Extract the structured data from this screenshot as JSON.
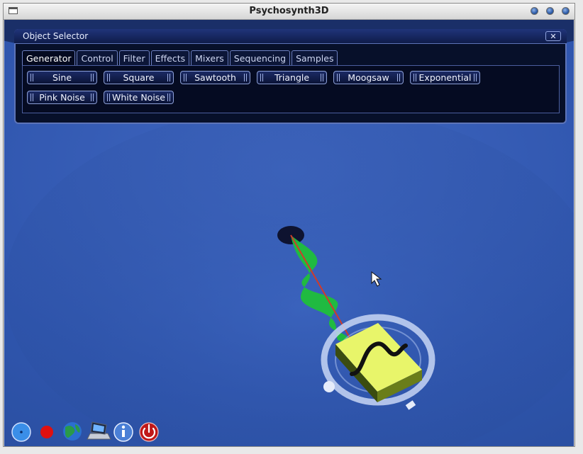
{
  "window": {
    "title": "Psychosynth3D"
  },
  "object_selector": {
    "title": "Object Selector",
    "close_glyph": "✕",
    "tabs": [
      {
        "label": "Generator",
        "active": true
      },
      {
        "label": "Control",
        "active": false
      },
      {
        "label": "Filter",
        "active": false
      },
      {
        "label": "Effects",
        "active": false
      },
      {
        "label": "Mixers",
        "active": false
      },
      {
        "label": "Sequencing",
        "active": false
      },
      {
        "label": "Samples",
        "active": false
      }
    ],
    "generator_buttons": [
      "Sine",
      "Square",
      "Sawtooth",
      "Triangle",
      "Moogsaw",
      "Exponential",
      "Pink Noise",
      "White Noise"
    ]
  },
  "scene": {
    "background_color": "#2f55ad",
    "wave_color": "#1fbf3a",
    "connection_color": "#d13a2a",
    "node_color": "#e8f56a",
    "node_icon": "sine-wave-icon"
  },
  "toolbar": [
    {
      "name": "circle-blue-icon",
      "color": "#3a8ee8"
    },
    {
      "name": "record-icon",
      "color": "#e01010"
    },
    {
      "name": "globe-icon",
      "color": "#2a9a4a"
    },
    {
      "name": "laptop-icon",
      "color": "#8a8f9a"
    },
    {
      "name": "info-icon",
      "color": "#4a7fd6"
    },
    {
      "name": "power-icon",
      "color": "#c01818"
    }
  ]
}
